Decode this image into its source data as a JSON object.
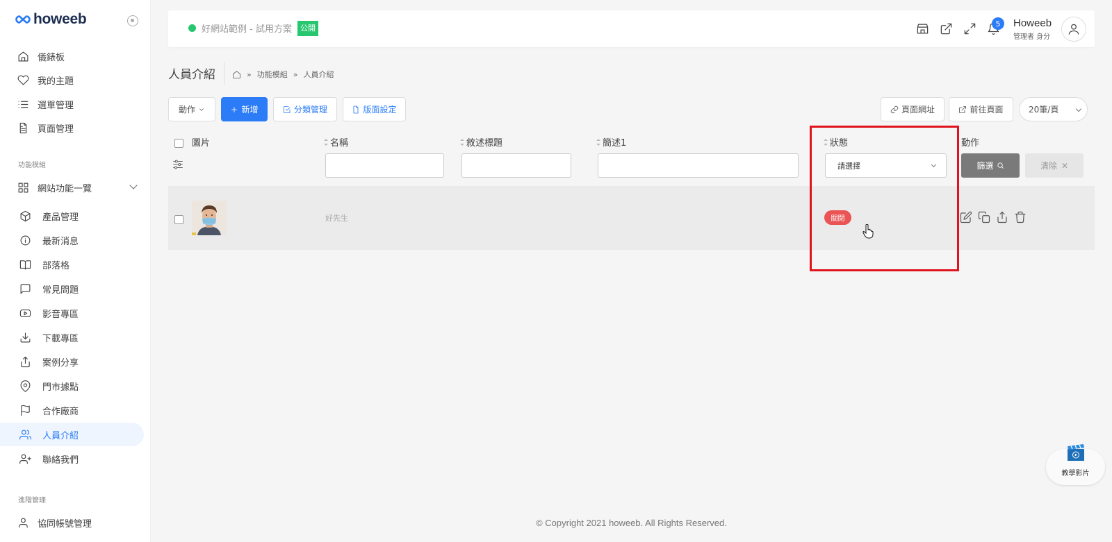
{
  "brand": {
    "logo_text": "howeeb"
  },
  "sidebar": {
    "items": [
      {
        "label": "儀錶板",
        "icon": "home-icon"
      },
      {
        "label": "我的主題",
        "icon": "heart-icon"
      },
      {
        "label": "選單管理",
        "icon": "list-icon"
      },
      {
        "label": "頁面管理",
        "icon": "file-icon"
      }
    ],
    "section_modules": "功能模組",
    "site_functions": "網站功能一覽",
    "module_items": [
      {
        "label": "產品管理",
        "icon": "box-icon"
      },
      {
        "label": "最新消息",
        "icon": "info-icon"
      },
      {
        "label": "部落格",
        "icon": "book-icon"
      },
      {
        "label": "常見問題",
        "icon": "message-icon"
      },
      {
        "label": "影音專區",
        "icon": "youtube-icon"
      },
      {
        "label": "下載專區",
        "icon": "download-icon"
      },
      {
        "label": "案例分享",
        "icon": "share-icon"
      },
      {
        "label": "門市據點",
        "icon": "map-pin-icon"
      },
      {
        "label": "合作廠商",
        "icon": "flag-icon"
      },
      {
        "label": "人員介紹",
        "icon": "users-icon",
        "active": true
      },
      {
        "label": "聯絡我們",
        "icon": "user-plus-icon"
      }
    ],
    "section_advanced": "進階管理",
    "advanced_items": [
      {
        "label": "協同帳號管理",
        "icon": "user-icon"
      }
    ]
  },
  "topbar": {
    "site_name": "好網站範例 - 試用方案",
    "public_label": "公開",
    "notification_count": "5",
    "user_name": "Howeeb",
    "user_role": "管理者 身分"
  },
  "page": {
    "title": "人員介紹",
    "breadcrumb": [
      "功能模組",
      "人員介紹"
    ]
  },
  "toolbar": {
    "action_label": "動作",
    "add_label": "新增",
    "category_label": "分類管理",
    "layout_label": "版面設定",
    "page_url_label": "頁面網址",
    "goto_page_label": "前往頁面",
    "per_page": "20筆/頁"
  },
  "table": {
    "columns": [
      "圖片",
      "名稱",
      "敘述標題",
      "簡述1",
      "狀態",
      "動作"
    ],
    "status_placeholder": "請選擇",
    "filter_label": "篩選",
    "clear_label": "清除",
    "rows": [
      {
        "name": "好先生",
        "status": "關閉"
      }
    ]
  },
  "footer": {
    "copyright": "© Copyright 2021 howeeb. All Rights Reserved."
  },
  "tutorial": {
    "label": "教學影片"
  },
  "colors": {
    "primary": "#2b7cf6",
    "success": "#28c76f",
    "danger": "#ea5455",
    "highlight": "#e0131d"
  }
}
